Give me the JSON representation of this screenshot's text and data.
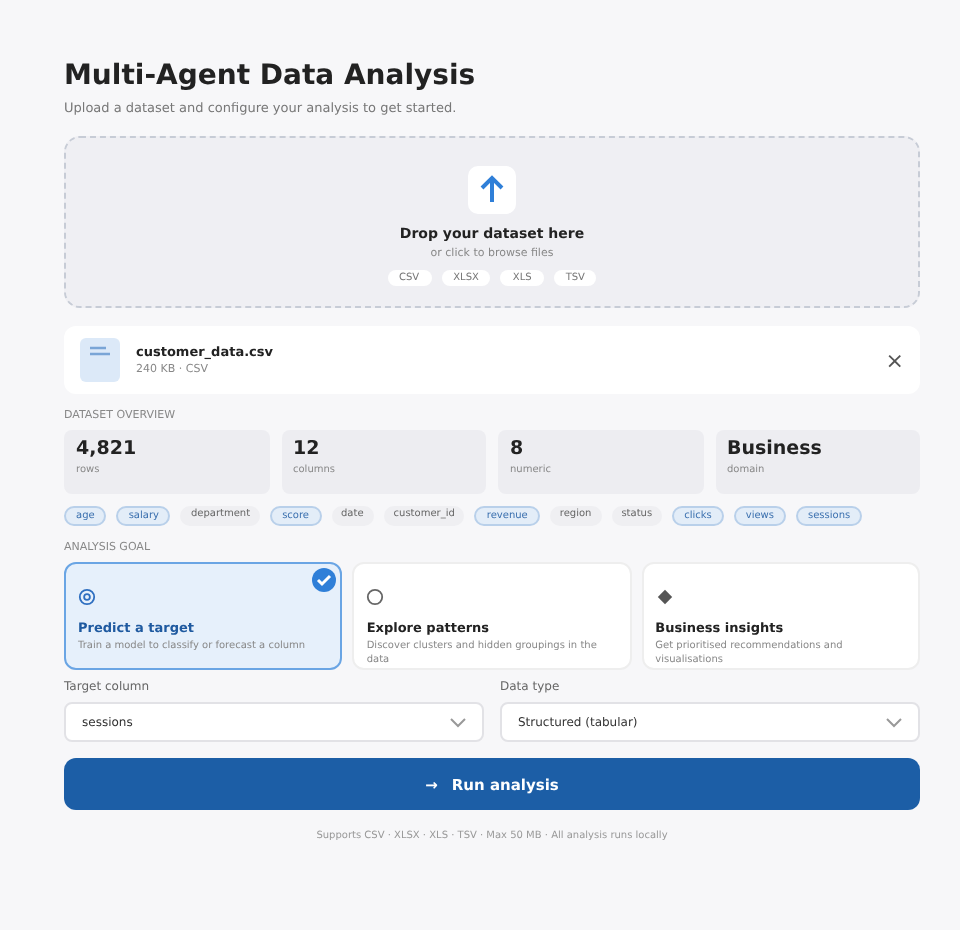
{
  "title": "Multi-Agent Data Analysis",
  "subtitle": "Upload a dataset and configure your analysis to get started.",
  "dropzone": {
    "title": "Drop your dataset here",
    "hint": "or click to browse files",
    "formats": [
      "CSV",
      "XLSX",
      "XLS",
      "TSV"
    ]
  },
  "file": {
    "name": "customer_data.csv",
    "meta": "240 KB · CSV",
    "close": "×"
  },
  "overview": {
    "label": "DATASET OVERVIEW",
    "stats": [
      {
        "value": "4,821",
        "label": "rows"
      },
      {
        "value": "12",
        "label": "columns"
      },
      {
        "value": "8",
        "label": "numeric"
      },
      {
        "value": "Business",
        "label": "domain"
      }
    ],
    "columns": [
      {
        "name": "age",
        "numeric": true
      },
      {
        "name": "salary",
        "numeric": true
      },
      {
        "name": "department",
        "numeric": false
      },
      {
        "name": "score",
        "numeric": true
      },
      {
        "name": "date",
        "numeric": false
      },
      {
        "name": "customer_id",
        "numeric": false
      },
      {
        "name": "revenue",
        "numeric": true
      },
      {
        "name": "region",
        "numeric": false
      },
      {
        "name": "status",
        "numeric": false
      },
      {
        "name": "clicks",
        "numeric": true
      },
      {
        "name": "views",
        "numeric": true
      },
      {
        "name": "sessions",
        "numeric": true
      }
    ]
  },
  "goal": {
    "label": "ANALYSIS GOAL",
    "options": [
      {
        "kind": "target",
        "title": "Predict a target",
        "desc": "Train a model to classify or forecast a column",
        "selected": true
      },
      {
        "kind": "explore",
        "title": "Explore patterns",
        "desc": "Discover clusters and hidden groupings in the data",
        "selected": false
      },
      {
        "kind": "insights",
        "title": "Business insights",
        "desc": "Get prioritised recommendations and visualisations",
        "selected": false
      }
    ]
  },
  "fields": [
    {
      "label": "Target column",
      "value": "sessions"
    },
    {
      "label": "Data type",
      "value": "Structured (tabular)"
    }
  ],
  "run_button": {
    "icon": "→",
    "label": "Run analysis"
  },
  "footer": "Supports CSV · XLSX · XLS · TSV · Max 50 MB · All analysis runs locally"
}
